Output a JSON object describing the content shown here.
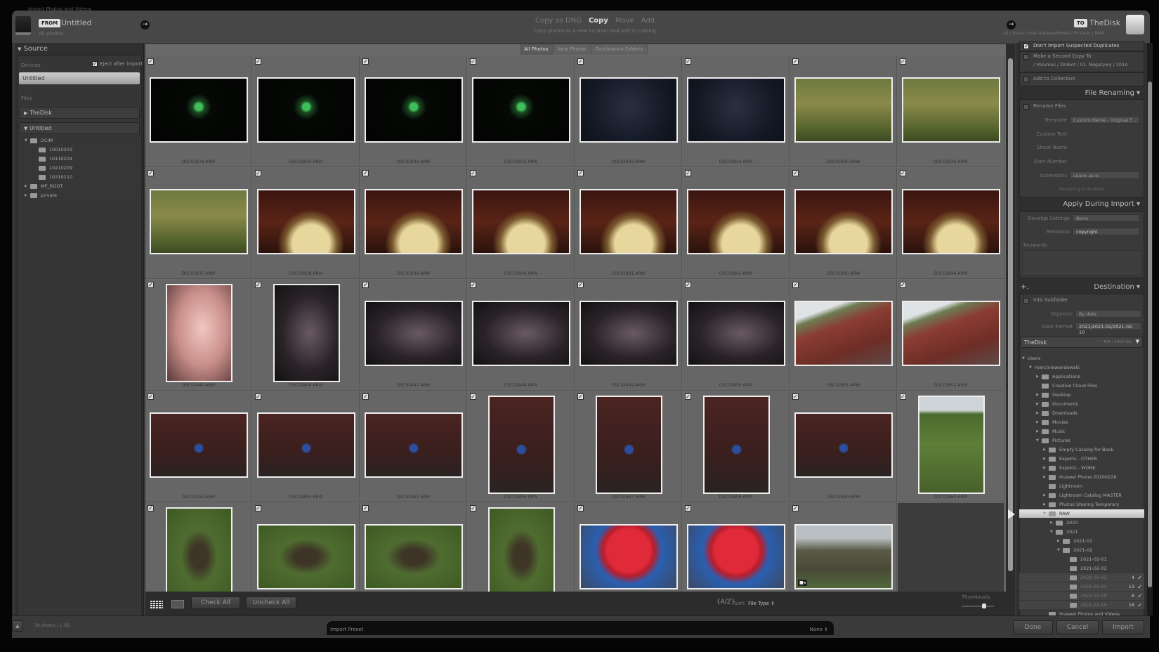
{
  "window_title": "Import Photos and Videos",
  "source_header": {
    "badge": "FROM",
    "name": "Untitled",
    "chevron": ":",
    "subtitle": "All photos"
  },
  "modes": {
    "items": [
      "Copy as DNG",
      "Copy",
      "Move",
      "Add"
    ],
    "active": "Copy",
    "description": "Copy photos to a new location and add to catalog"
  },
  "dest_header": {
    "badge": "TO",
    "name": "TheDisk",
    "chevron": ":",
    "path": "...sk / Users / marcinlewandowski / Pictures / RAW"
  },
  "filter_tabs": [
    {
      "label": "All Photos",
      "active": true
    },
    {
      "label": "New Photos",
      "active": false
    },
    {
      "label": "Destination Folders",
      "active": false
    }
  ],
  "left_panel": {
    "title": "Source",
    "devices_label": "Devices",
    "eject_label": "Eject after import",
    "eject_checked": true,
    "device": "Untitled",
    "files_label": "Files",
    "volumes": [
      {
        "name": "TheDisk",
        "expanded": false
      },
      {
        "name": "Untitled",
        "expanded": true
      }
    ],
    "tree": [
      {
        "name": "DCIM",
        "depth": 0,
        "toggle": "open"
      },
      {
        "name": "10010203",
        "depth": 1
      },
      {
        "name": "10110204",
        "depth": 1
      },
      {
        "name": "10210209",
        "depth": 1
      },
      {
        "name": "10310210",
        "depth": 1
      },
      {
        "name": "MP_ROOT",
        "depth": 0,
        "toggle": "closed"
      },
      {
        "name": "private",
        "depth": 0,
        "toggle": "closed"
      }
    ]
  },
  "photos": [
    {
      "file": "DSC02829.ARW",
      "checked": true
    },
    {
      "file": "DSC02830.ARW",
      "checked": true
    },
    {
      "file": "DSC02831.ARW",
      "checked": true
    },
    {
      "file": "DSC02832.ARW",
      "checked": true
    },
    {
      "file": "DSC02833.ARW",
      "checked": true
    },
    {
      "file": "DSC02834.ARW",
      "checked": true
    },
    {
      "file": "DSC02835.ARW",
      "checked": true
    },
    {
      "file": "DSC02836.ARW",
      "checked": true
    },
    {
      "file": "DSC02837.ARW",
      "checked": true
    },
    {
      "file": "DSC02838.ARW",
      "checked": true
    },
    {
      "file": "DSC02839.ARW",
      "checked": true
    },
    {
      "file": "DSC02840.ARW",
      "checked": true
    },
    {
      "file": "DSC02841.ARW",
      "checked": true
    },
    {
      "file": "DSC02842.ARW",
      "checked": true
    },
    {
      "file": "DSC02843.ARW",
      "checked": true
    },
    {
      "file": "DSC02844.ARW",
      "checked": true
    },
    {
      "file": "DSC02845.ARW",
      "checked": true
    },
    {
      "file": "DSC02846.ARW",
      "checked": true
    },
    {
      "file": "DSC02847.ARW",
      "checked": true
    },
    {
      "file": "DSC02848.ARW",
      "checked": true
    },
    {
      "file": "DSC02849.ARW",
      "checked": true
    },
    {
      "file": "DSC02850.ARW",
      "checked": true
    },
    {
      "file": "DSC02851.ARW",
      "checked": true
    },
    {
      "file": "DSC02852.ARW",
      "checked": true
    },
    {
      "file": "DSC02853.ARW",
      "checked": true
    },
    {
      "file": "DSC02854.ARW",
      "checked": true
    },
    {
      "file": "DSC02855.ARW",
      "checked": true
    },
    {
      "file": "DSC02856.ARW",
      "checked": true
    },
    {
      "file": "DSC02857.ARW",
      "checked": true
    },
    {
      "file": "DSC02858.ARW",
      "checked": true
    },
    {
      "file": "DSC02859.ARW",
      "checked": true
    },
    {
      "file": "DSC02860.ARW",
      "checked": true
    },
    {
      "file": "",
      "checked": true
    },
    {
      "file": "",
      "checked": true
    },
    {
      "file": "",
      "checked": true
    },
    {
      "file": "",
      "checked": true
    },
    {
      "file": "",
      "checked": true
    },
    {
      "file": "",
      "checked": true
    },
    {
      "file": "",
      "checked": true,
      "video": true
    }
  ],
  "grid_toolbar": {
    "check_all": "Check All",
    "uncheck_all": "Uncheck All",
    "sort_label": "Sort:",
    "sort_value": "File Type",
    "thumbnails_label": "Thumbnails",
    "thumbnail_size": 0.7
  },
  "right_panel": {
    "dont_import_duplicates": {
      "label": "Don't Import Suspected Duplicates",
      "checked": true
    },
    "second_copy": {
      "label": "Make a Second Copy To :",
      "path": "/ Volumes / Drobot / 01. Negatywy / 2014",
      "checked": false
    },
    "add_to_collection": {
      "label": "Add to Collection",
      "checked": false
    },
    "file_renaming": {
      "title": "File Renaming",
      "rename_label": "Rename Files",
      "template_label": "Template",
      "template_value": "Custom Name - Original F...",
      "custom_text_label": "Custom Text",
      "shoot_name_label": "Shoot Name",
      "start_number_label": "Start Number",
      "extensions_label": "Extensions",
      "extensions_value": "Leave as-is",
      "status": "Renaming is disabled"
    },
    "apply": {
      "title": "Apply During Import",
      "develop_label": "Develop Settings",
      "develop_value": "None",
      "metadata_label": "Metadata",
      "metadata_value": "copyright",
      "keywords_label": "Keywords"
    },
    "destination": {
      "title": "Destination",
      "plus": "+.",
      "subfolder_label": "Into Subfolder",
      "organize_label": "Organize",
      "organize_value": "By date",
      "date_format_label": "Date Format",
      "date_format_value": "2021/2021-02/2021-02-10",
      "volume": "TheDisk",
      "volume_space": "404 / 1000 GB"
    },
    "tree": [
      {
        "name": "Users",
        "depth": 0,
        "toggle": "open",
        "nofolder": true
      },
      {
        "name": "marcinlewandowski",
        "depth": 1,
        "toggle": "open",
        "nofolder": true
      },
      {
        "name": "Applications",
        "depth": 2,
        "toggle": "closed"
      },
      {
        "name": "Creative Cloud Files",
        "depth": 2
      },
      {
        "name": "Desktop",
        "depth": 2,
        "toggle": "closed"
      },
      {
        "name": "Documents",
        "depth": 2,
        "toggle": "closed"
      },
      {
        "name": "Downloads",
        "depth": 2,
        "toggle": "closed"
      },
      {
        "name": "Movies",
        "depth": 2,
        "toggle": "closed"
      },
      {
        "name": "Music",
        "depth": 2,
        "toggle": "closed"
      },
      {
        "name": "Pictures",
        "depth": 2,
        "toggle": "open"
      },
      {
        "name": "Empty Catalog for Book",
        "depth": 3,
        "toggle": "closed"
      },
      {
        "name": "Exports - OTHER",
        "depth": 3,
        "toggle": "closed"
      },
      {
        "name": "Exports - WORK",
        "depth": 3,
        "toggle": "closed"
      },
      {
        "name": "Huawei Phone 20200226",
        "depth": 3,
        "toggle": "closed"
      },
      {
        "name": "Lightroom",
        "depth": 3
      },
      {
        "name": "Lightroom Catalog MASTER",
        "depth": 3,
        "toggle": "closed"
      },
      {
        "name": "Photos Sharing Temporary",
        "depth": 3,
        "toggle": "closed"
      },
      {
        "name": "RAW",
        "depth": 3,
        "toggle": "open",
        "selected": true
      },
      {
        "name": "2020",
        "depth": 4,
        "toggle": "closed"
      },
      {
        "name": "2021",
        "depth": 4,
        "toggle": "open"
      },
      {
        "name": "2021-01",
        "depth": 5,
        "toggle": "closed"
      },
      {
        "name": "2021-02",
        "depth": 5,
        "toggle": "open"
      },
      {
        "name": "2021-02-01",
        "depth": 6
      },
      {
        "name": "2021-02-02",
        "depth": 6
      },
      {
        "name": "2021-02-03",
        "depth": 6,
        "new": true,
        "count": "4",
        "checked": true
      },
      {
        "name": "2021-02-04",
        "depth": 6,
        "new": true,
        "count": "13",
        "checked": true
      },
      {
        "name": "2021-02-09",
        "depth": 6,
        "new": true,
        "count": "6",
        "checked": true
      },
      {
        "name": "2021-02-10",
        "depth": 6,
        "new": true,
        "count": "16",
        "checked": true
      },
      {
        "name": "Huawei Photos and Videos",
        "depth": 3
      }
    ]
  },
  "bottom": {
    "summary": "39 photos / 1 GB",
    "preset_label": "Import Preset",
    "preset_value": "None",
    "done": "Done",
    "cancel": "Cancel",
    "import": "Import"
  }
}
